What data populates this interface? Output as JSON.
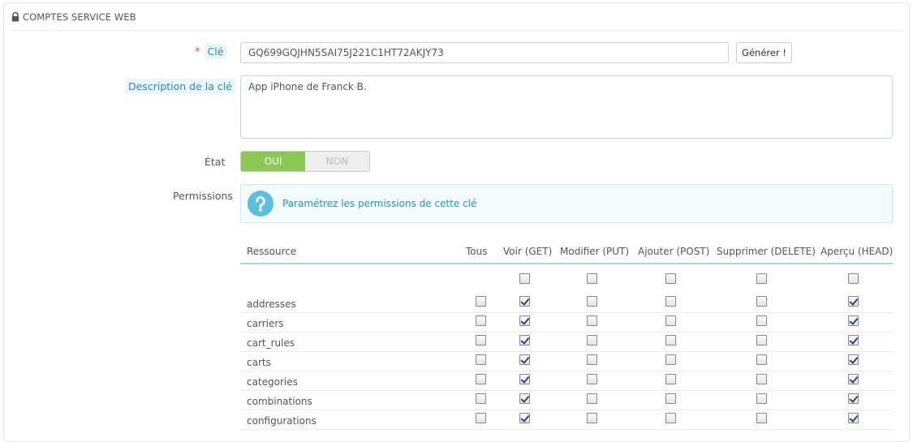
{
  "panel": {
    "title": "COMPTES SERVICE WEB",
    "icon": "lock-icon"
  },
  "form": {
    "key_label": "Clé",
    "key_required_marker": "*",
    "key_value": "GQ699GQJHN5SAI75J221C1HT72AKJY73",
    "generate_button": "Générer !",
    "description_label": "Description de la clé",
    "description_value": "App iPhone de Franck B.",
    "state_label": "État",
    "state_on": "OUI",
    "state_off": "NON",
    "state_value": "OUI",
    "permissions_label": "Permissions",
    "permissions_help": "Paramétrez les permissions de cette clé"
  },
  "colors": {
    "switch_on": "#8bc954",
    "info_text": "#1f95bd",
    "info_icon": "#5bc0de",
    "required": "#e0484f"
  },
  "table": {
    "headers": [
      "Ressource",
      "Tous",
      "Voir (GET)",
      "Modifier (PUT)",
      "Ajouter (POST)",
      "Supprimer (DELETE)",
      "Aperçu (HEAD)"
    ],
    "header_row_checks": [
      false,
      false,
      false,
      false,
      false
    ],
    "rows": [
      {
        "name": "addresses",
        "checks": [
          false,
          true,
          false,
          false,
          false,
          true
        ]
      },
      {
        "name": "carriers",
        "checks": [
          false,
          true,
          false,
          false,
          false,
          true
        ]
      },
      {
        "name": "cart_rules",
        "checks": [
          false,
          true,
          false,
          false,
          false,
          true
        ]
      },
      {
        "name": "carts",
        "checks": [
          false,
          true,
          false,
          false,
          false,
          true
        ]
      },
      {
        "name": "categories",
        "checks": [
          false,
          true,
          false,
          false,
          false,
          true
        ]
      },
      {
        "name": "combinations",
        "checks": [
          false,
          true,
          false,
          false,
          false,
          true
        ]
      },
      {
        "name": "configurations",
        "checks": [
          false,
          true,
          false,
          false,
          false,
          true
        ]
      }
    ]
  }
}
